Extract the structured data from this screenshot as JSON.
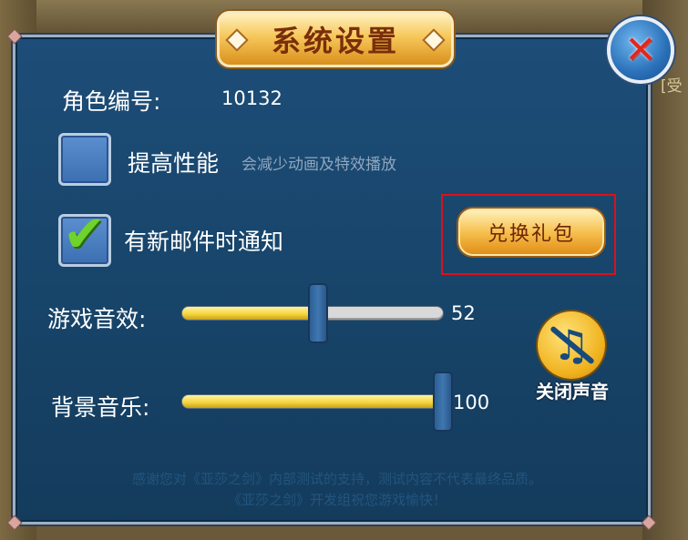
{
  "window": {
    "title": "系统设置",
    "side_tag": "[受"
  },
  "role": {
    "label": "角色编号:",
    "value": "10132"
  },
  "performance": {
    "label": "提高性能",
    "hint": "会减少动画及特效播放",
    "checked": false
  },
  "mail_notify": {
    "label": "有新邮件时通知",
    "checked": true
  },
  "gift": {
    "button_label": "兑换礼包"
  },
  "sound_effects": {
    "label": "游戏音效:",
    "value": "52",
    "level": 52
  },
  "music": {
    "label": "背景音乐:",
    "value": "100",
    "level": 100
  },
  "mute": {
    "label": "关闭声音"
  },
  "notice": {
    "line1": "感谢您对《亚莎之剑》内部测试的支持，测试内容不代表最终品质。",
    "line2": "《亚莎之剑》开发组祝您游戏愉快！"
  },
  "colors": {
    "panel_bg": "#1d4d78",
    "gold": "#f6c75a",
    "highlight": "#e00f1a",
    "slider_fill": "#f3d23a"
  },
  "icons": {
    "close": "close-icon",
    "check": "checkmark-icon",
    "mute": "mute-music-icon"
  }
}
